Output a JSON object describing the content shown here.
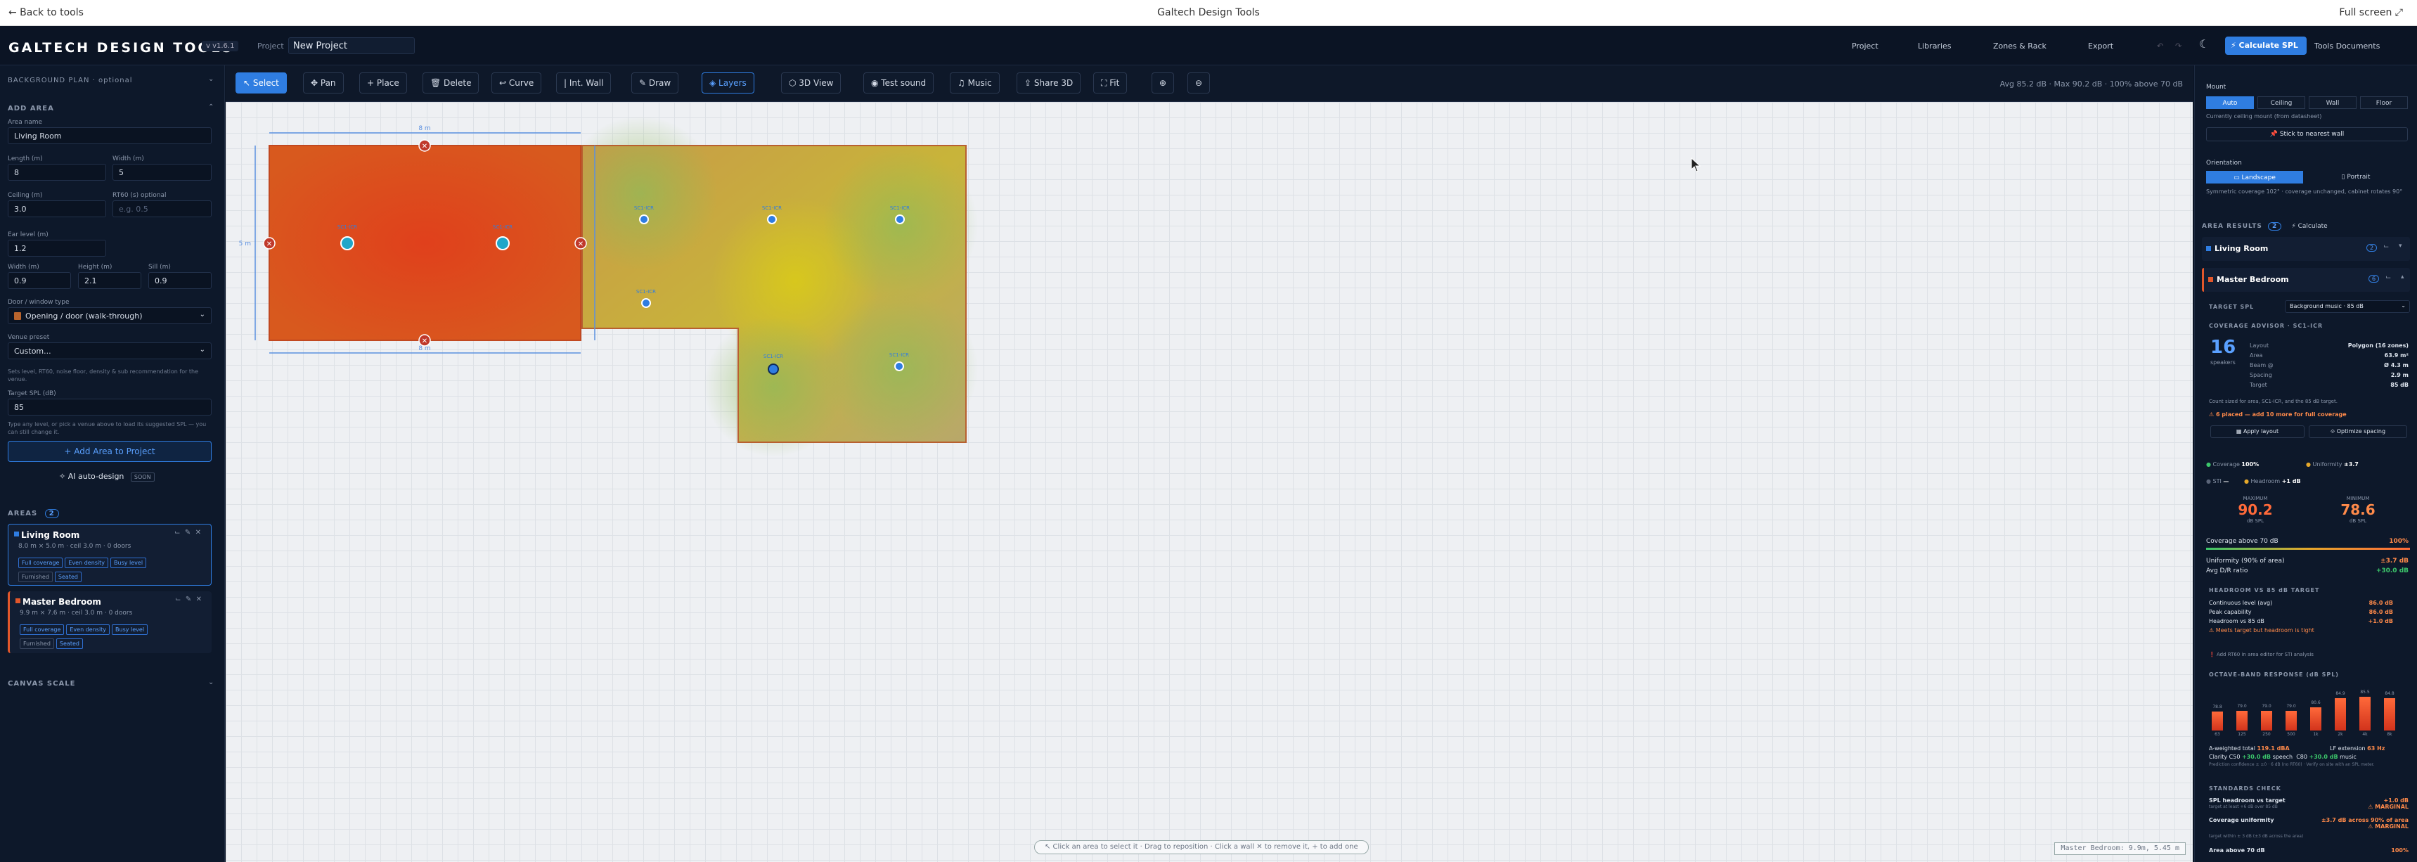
{
  "browser": {
    "back": "← Back to tools",
    "title": "Galtech Design Tools",
    "fullscreen": "Full screen ⤢"
  },
  "header": {
    "logo": "GALTECH DESIGN TOOLS",
    "version": "v v1.6.1",
    "project_label": "Project",
    "project_name": "New Project",
    "menus": [
      "Project",
      "Libraries",
      "Zones & Rack",
      "Export"
    ],
    "calculate": "⚡ Calculate SPL",
    "docs": "Tools Documents"
  },
  "sidebar": {
    "background_plan": "BACKGROUND PLAN · optional",
    "add_area": "ADD AREA",
    "area_name_label": "Area name",
    "area_name": "Living Room",
    "length_label": "Length (m)",
    "length": "8",
    "width_label": "Width (m)",
    "width": "5",
    "ceiling_label": "Ceiling (m)",
    "ceiling": "3.0",
    "rt60_label": "RT60 (s) optional",
    "rt60_placeholder": "e.g. 0.5",
    "ear_label": "Ear level (m)",
    "ear": "1.2",
    "dw_label": "Width (m)",
    "dw": "0.9",
    "dh_label": "Height (m)",
    "dh": "2.1",
    "sill_label": "Sill (m)",
    "sill": "0.9",
    "door_type_label": "Door / window type",
    "door_type": "Opening / door (walk-through)",
    "venue_label": "Venue preset",
    "venue": "Custom...",
    "venue_hint": "Sets level, RT60, noise floor, density & sub recommendation for the venue.",
    "target_label": "Target SPL (dB)",
    "target": "85",
    "target_hint": "Type any level, or pick a venue above to load its suggested SPL — you can still change it.",
    "add_area_btn": "+ Add Area to Project",
    "ai_design": "AI auto-design",
    "ai_badge": "SOON",
    "areas_title": "AREAS",
    "areas_count": "2",
    "areas": [
      {
        "name": "Living Room",
        "meta": "8.0 m × 5.0 m · ceil 3.0 m · 0 doors",
        "chips": [
          "Full coverage",
          "Even density",
          "Busy level"
        ],
        "chips2": [
          "Furnished",
          "Seated"
        ],
        "color": "#2f7de1"
      },
      {
        "name": "Master Bedroom",
        "meta": "9.9 m × 7.6 m · ceil 3.0 m · 0 doors",
        "chips": [
          "Full coverage",
          "Even density",
          "Busy level"
        ],
        "chips2": [
          "Furnished",
          "Seated"
        ],
        "color": "#e2572b"
      }
    ],
    "canvas_scale": "CANVAS SCALE"
  },
  "toolbar": {
    "buttons": [
      "↖ Select",
      "✥ Pan",
      "+ Place",
      "🗑 Delete",
      "↩ Curve",
      "| Int. Wall",
      "✎ Draw",
      "◈ Layers",
      "⬡ 3D View",
      "◉ Test sound",
      "♫ Music",
      "⇪ Share 3D",
      "⛶ Fit",
      "⊕",
      "⊖"
    ],
    "stats": "Avg 85.2 dB · Max 90.2 dB · 100% above 70 dB"
  },
  "canvas": {
    "status": "↖ Click an area to select it · Drag to reposition · Click a wall ✕ to remove it, + to add one",
    "coord": "Master Bedroom: 9.9m, 5.45 m",
    "dim_top": "8 m",
    "dim_left": "5 m",
    "dim_bottom": "8 m",
    "sp_labels": [
      "SC1-ICR",
      "SC1-ICR",
      "SC1-ICR",
      "SC1-ICR",
      "SC1-ICR",
      "SC1-ICR",
      "SC1-ICR",
      "SC1-ICR"
    ]
  },
  "rpanel": {
    "mount": "Mount",
    "mount_opts": [
      "Auto",
      "Ceiling",
      "Wall",
      "Floor"
    ],
    "mount_note": "Currently ceiling mount (from datasheet)",
    "stick": "📌 Stick to nearest wall",
    "orient": "Orientation",
    "orient_opts": [
      "▭ Landscape",
      "▯ Portrait"
    ],
    "orient_note": "Symmetric coverage 102° · coverage unchanged, cabinet rotates 90°",
    "results": "AREA RESULTS",
    "results_count": "2",
    "calc": "⚡ Calculate",
    "area1": "Living Room",
    "area1_badge": "2",
    "area2": "Master Bedroom",
    "area2_badge": "6",
    "target_spl": "TARGET SPL",
    "target_sel": "Background music · 85 dB",
    "advisor": "COVERAGE ADVISOR · SC1-ICR",
    "count": "16",
    "count_lbl": "speakers",
    "kv": [
      [
        "Layout",
        "Polygon (16 zones)"
      ],
      [
        "Area",
        "63.9 m²"
      ],
      [
        "Beam @",
        "Ø 4.3 m"
      ],
      [
        "Spacing",
        "2.9 m"
      ],
      [
        "Target",
        "85 dB"
      ]
    ],
    "advisor_note": "Count sized for area, SC1-ICR, and the 85 dB target.",
    "warn": "⚠ 6 placed — add 10 more for full coverage",
    "apply": "▦ Apply layout",
    "optimize": "⟐ Optimize spacing",
    "coverage": "Coverage",
    "coverage_v": "100%",
    "uniformity": "Uniformity",
    "uniformity_v": "±3.7",
    "sti": "STI",
    "sti_v": "—",
    "headroom": "Headroom",
    "headroom_v": "+1 dB",
    "max_lbl": "MAXIMUM",
    "max": "90.2",
    "max_unit": "dB SPL",
    "min_lbl": "MINIMUM",
    "min": "78.6",
    "min_unit": "dB SPL",
    "cov70": "Coverage above 70 dB",
    "cov70_v": "100%",
    "unif90": "Uniformity (90% of area)",
    "unif90_v": "±3.7 dB",
    "dr": "Avg D/R ratio",
    "dr_v": "+30.0 dB",
    "hr_title": "HEADROOM VS 85 dB TARGET",
    "hr": [
      [
        "Continuous level (avg)",
        "86.0 dB"
      ],
      [
        "Peak capability",
        "86.0 dB"
      ],
      [
        "Headroom vs 85 dB",
        "+1.0 dB"
      ]
    ],
    "hr_warn": "⚠ Meets target but headroom is tight",
    "rt60_note": "❗ Add RT60 in area editor for STI analysis",
    "octave_title": "OCTAVE-BAND RESPONSE (dB SPL)",
    "octave_freqs": [
      "63",
      "125",
      "250",
      "500",
      "1k",
      "2k",
      "4k",
      "8k"
    ],
    "octave_vals": [
      78.8,
      79.0,
      79.0,
      79.0,
      80.6,
      84.9,
      85.5,
      84.8
    ],
    "aw": "A-weighted total",
    "aw_v": "119.1 dBA",
    "lf": "LF extension",
    "lf_v": "63 Hz",
    "clarity": "Clarity C50",
    "clarity_v": "+30.0 dB",
    "clarity2": "speech",
    "c80": "C80",
    "c80_v": "+30.0 dB",
    "c80_2": "music",
    "clarity_note": "Prediction confidence ± ±0 · 6 dB (no RT60) · Verify on site with an SPL meter.",
    "std_title": "STANDARDS CHECK",
    "std": [
      [
        "SPL headroom vs target",
        "+1.0 dB",
        "⚠ MARGINAL"
      ],
      [
        "Coverage uniformity",
        "±3.7 dB across 90% of area",
        "⚠ MARGINAL"
      ],
      [
        "Area above 70 dB",
        "100%",
        ""
      ]
    ],
    "std_sub1": "target at least +6 dB over 85 dB",
    "std_sub2": "target within ± 3 dB (±3 dB across the area)"
  }
}
